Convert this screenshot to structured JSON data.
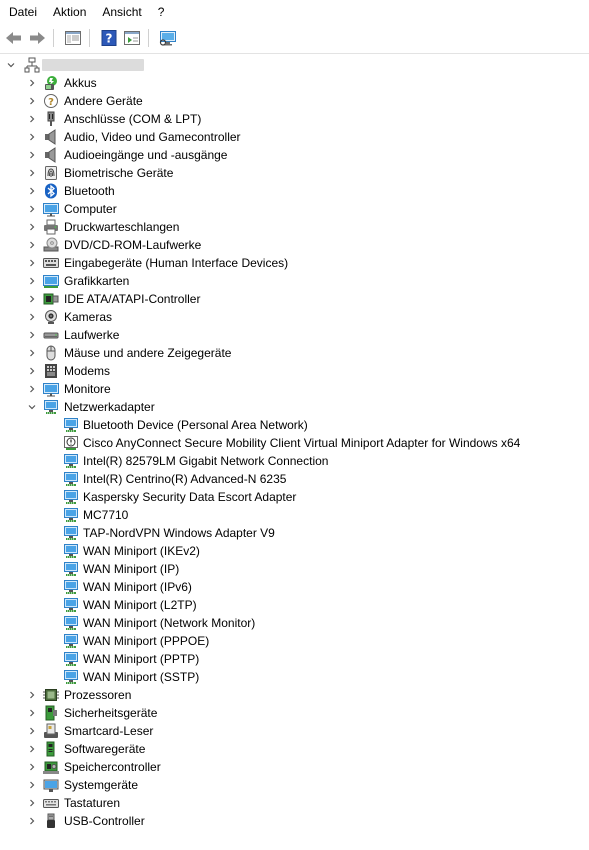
{
  "menubar": {
    "items": [
      "Datei",
      "Aktion",
      "Ansicht",
      "?"
    ]
  },
  "toolbar": {
    "buttons": [
      "back-icon",
      "forward-icon",
      "show-hide-console-tree-icon",
      "help-icon",
      "properties-icon",
      "scan-hardware-icon"
    ]
  },
  "tree": {
    "root": {
      "icon": "computer-network-icon",
      "label": ""
    },
    "categories": [
      {
        "label": "Akkus",
        "icon": "battery-icon"
      },
      {
        "label": "Andere Geräte",
        "icon": "unknown-device-icon"
      },
      {
        "label": "Anschlüsse (COM & LPT)",
        "icon": "port-icon"
      },
      {
        "label": "Audio, Video und Gamecontroller",
        "icon": "speaker-icon"
      },
      {
        "label": "Audioeingänge und -ausgänge",
        "icon": "speaker-icon"
      },
      {
        "label": "Biometrische Geräte",
        "icon": "fingerprint-icon"
      },
      {
        "label": "Bluetooth",
        "icon": "bluetooth-icon"
      },
      {
        "label": "Computer",
        "icon": "monitor-icon"
      },
      {
        "label": "Druckwarteschlangen",
        "icon": "printer-icon"
      },
      {
        "label": "DVD/CD-ROM-Laufwerke",
        "icon": "disc-drive-icon"
      },
      {
        "label": "Eingabegeräte (Human Interface Devices)",
        "icon": "hid-icon"
      },
      {
        "label": "Grafikkarten",
        "icon": "display-adapter-icon"
      },
      {
        "label": "IDE ATA/ATAPI-Controller",
        "icon": "ide-controller-icon"
      },
      {
        "label": "Kameras",
        "icon": "camera-icon"
      },
      {
        "label": "Laufwerke",
        "icon": "disk-drive-icon"
      },
      {
        "label": "Mäuse und andere Zeigegeräte",
        "icon": "mouse-icon"
      },
      {
        "label": "Modems",
        "icon": "modem-icon"
      },
      {
        "label": "Monitore",
        "icon": "monitor-icon"
      },
      {
        "label": "Netzwerkadapter",
        "icon": "network-adapter-icon",
        "expanded": true,
        "children": [
          {
            "label": "Bluetooth Device (Personal Area Network)",
            "icon": "network-adapter-icon"
          },
          {
            "label": "Cisco AnyConnect Secure Mobility Client Virtual Miniport Adapter for Windows x64",
            "icon": "network-adapter-warning-icon"
          },
          {
            "label": "Intel(R) 82579LM Gigabit Network Connection",
            "icon": "network-adapter-icon"
          },
          {
            "label": "Intel(R) Centrino(R) Advanced-N 6235",
            "icon": "network-adapter-icon"
          },
          {
            "label": "Kaspersky Security Data Escort Adapter",
            "icon": "network-adapter-icon"
          },
          {
            "label": "MC7710",
            "icon": "network-adapter-icon"
          },
          {
            "label": "TAP-NordVPN Windows Adapter V9",
            "icon": "network-adapter-icon"
          },
          {
            "label": "WAN Miniport (IKEv2)",
            "icon": "network-adapter-icon"
          },
          {
            "label": "WAN Miniport (IP)",
            "icon": "network-adapter-icon"
          },
          {
            "label": "WAN Miniport (IPv6)",
            "icon": "network-adapter-icon"
          },
          {
            "label": "WAN Miniport (L2TP)",
            "icon": "network-adapter-icon"
          },
          {
            "label": "WAN Miniport (Network Monitor)",
            "icon": "network-adapter-icon"
          },
          {
            "label": "WAN Miniport (PPPOE)",
            "icon": "network-adapter-icon"
          },
          {
            "label": "WAN Miniport (PPTP)",
            "icon": "network-adapter-icon"
          },
          {
            "label": "WAN Miniport (SSTP)",
            "icon": "network-adapter-icon"
          }
        ]
      },
      {
        "label": "Prozessoren",
        "icon": "processor-icon"
      },
      {
        "label": "Sicherheitsgeräte",
        "icon": "security-device-icon"
      },
      {
        "label": "Smartcard-Leser",
        "icon": "smartcard-reader-icon"
      },
      {
        "label": "Softwaregeräte",
        "icon": "software-device-icon"
      },
      {
        "label": "Speichercontroller",
        "icon": "storage-controller-icon"
      },
      {
        "label": "Systemgeräte",
        "icon": "system-device-icon"
      },
      {
        "label": "Tastaturen",
        "icon": "keyboard-icon"
      },
      {
        "label": "USB-Controller",
        "icon": "usb-icon"
      }
    ]
  }
}
